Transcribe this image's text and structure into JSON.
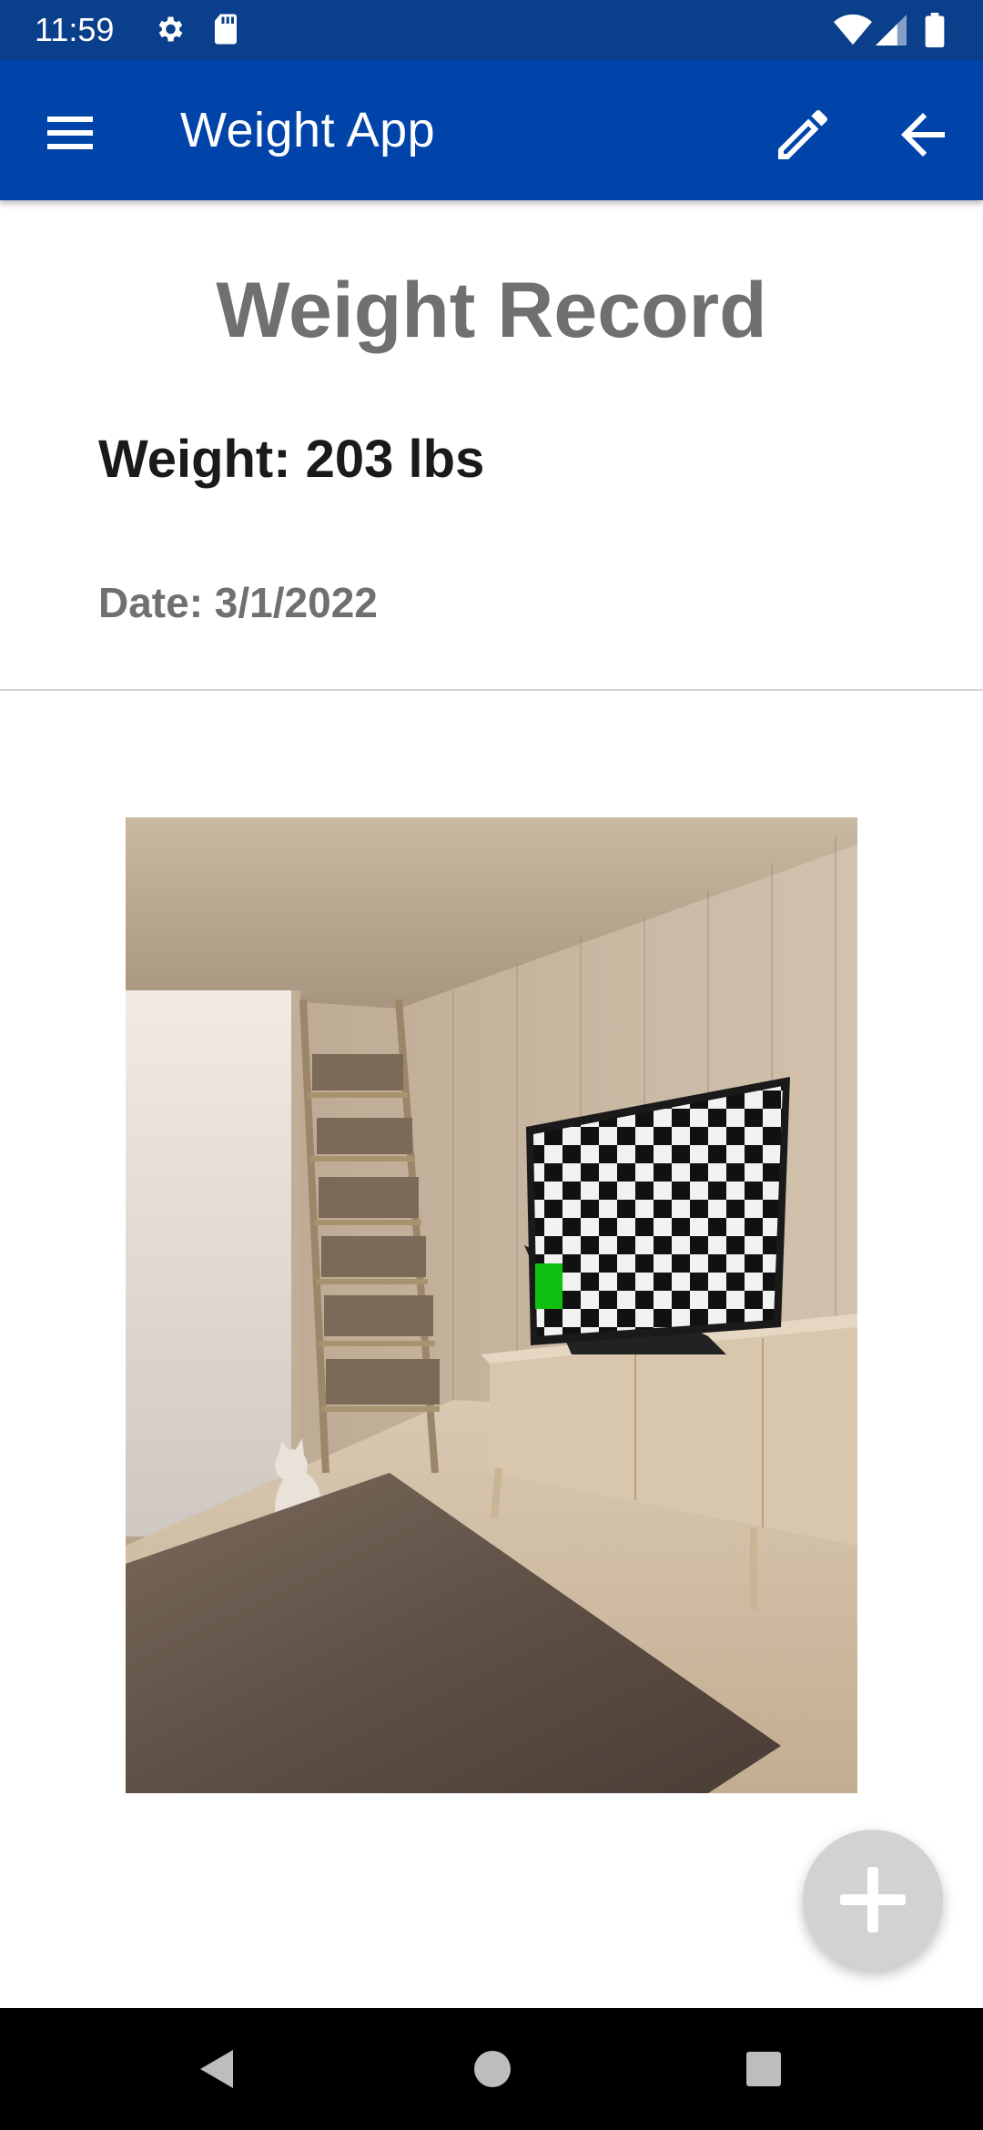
{
  "status_bar": {
    "time": "11:59",
    "icons": [
      "settings-icon",
      "sd-card-icon",
      "wifi-icon",
      "cellular-signal-icon",
      "battery-icon"
    ]
  },
  "app_bar": {
    "title": "Weight App",
    "background_color": "#0044aa",
    "icons": [
      "menu-icon",
      "edit-pencil-icon",
      "arrow-back-icon"
    ]
  },
  "record": {
    "heading": "Weight Record",
    "weight_text": "Weight: 203 lbs",
    "date_text": "Date: 3/1/2022"
  },
  "fab": {
    "icon": "add-icon",
    "color": "#d2d2d2"
  },
  "nav_bar": {
    "icons": [
      "back-triangle-icon",
      "home-circle-icon",
      "recents-square-icon"
    ]
  }
}
